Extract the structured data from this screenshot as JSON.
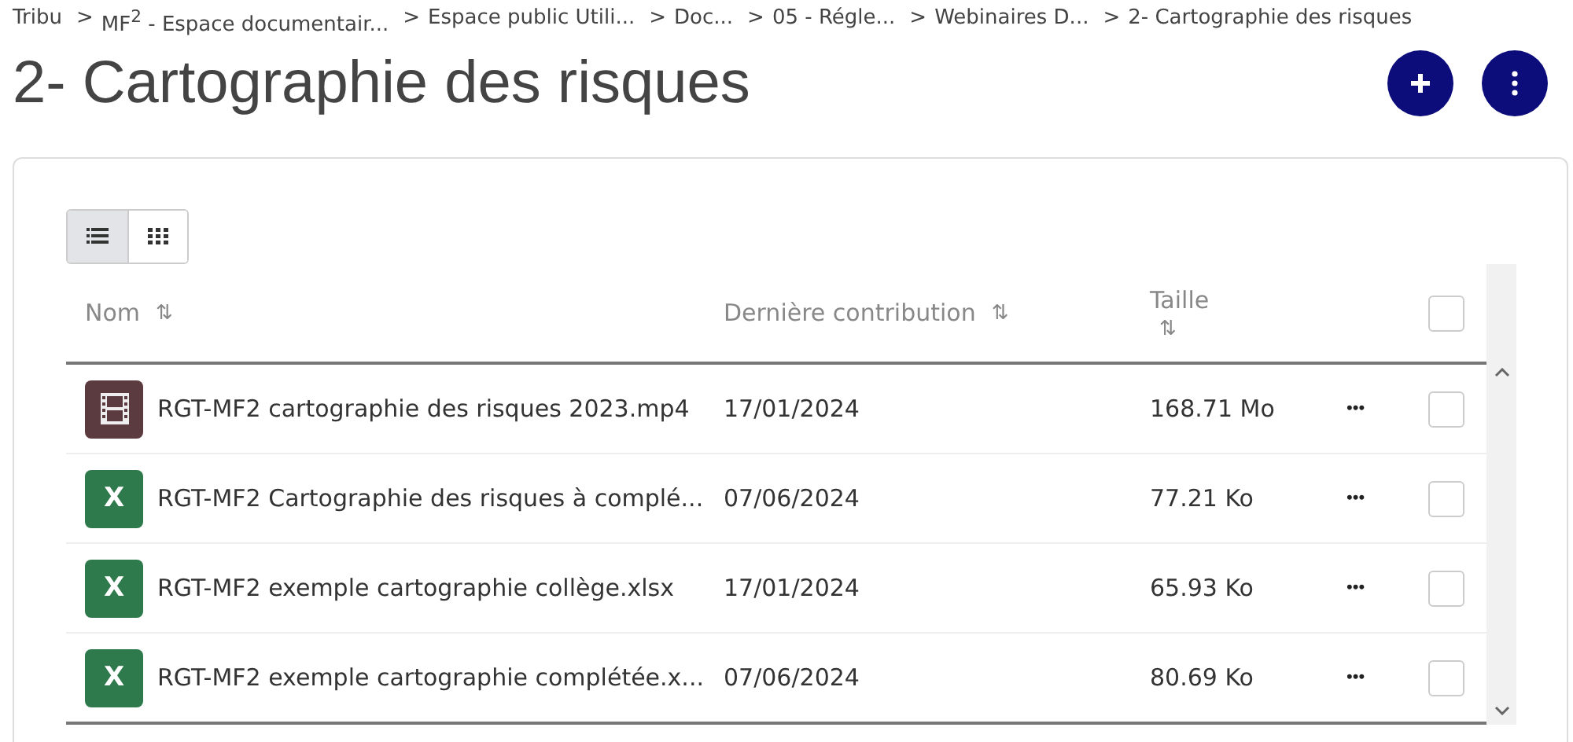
{
  "breadcrumb": {
    "separator": ">",
    "items": [
      "Tribu",
      "MF$^{2}$ - Espace documentair...",
      "Espace public Utili...",
      "Doc...",
      "05 - Régle...",
      "Webinaires D...",
      "2- Cartographie des risques"
    ]
  },
  "title": "2- Cartographie des risques",
  "actions": [
    {
      "kind": "add"
    },
    {
      "kind": "more"
    }
  ],
  "view_toggle": [
    {
      "kind": "list",
      "selected": true
    },
    {
      "kind": "grid",
      "selected": false
    }
  ],
  "table": {
    "sort_icon": "⇅",
    "columns": [
      {
        "kind": "name",
        "label": "Nom"
      },
      {
        "kind": "date",
        "label": "Dernière contribution"
      },
      {
        "kind": "size",
        "label": "Taille"
      }
    ],
    "select_all": {
      "checked": false
    },
    "rows": [
      {
        "kind": "video",
        "name": "RGT-MF2 cartographie des risques 2023.mp4",
        "date": "17/01/2024",
        "size": "168.71 Mo",
        "menu": "•••",
        "checked": false
      },
      {
        "kind": "excel",
        "badge": "X",
        "name": "RGT-MF2 Cartographie des risques à complé...",
        "date": "07/06/2024",
        "size": "77.21 Ko",
        "menu": "•••",
        "checked": false
      },
      {
        "kind": "excel",
        "badge": "X",
        "name": "RGT-MF2 exemple cartographie collège.xlsx",
        "date": "17/01/2024",
        "size": "65.93 Ko",
        "menu": "•••",
        "checked": false
      },
      {
        "kind": "excel",
        "badge": "X",
        "name": "RGT-MF2 exemple cartographie complétée.x...",
        "date": "07/06/2024",
        "size": "80.69 Ko",
        "menu": "•••",
        "checked": false
      }
    ]
  }
}
